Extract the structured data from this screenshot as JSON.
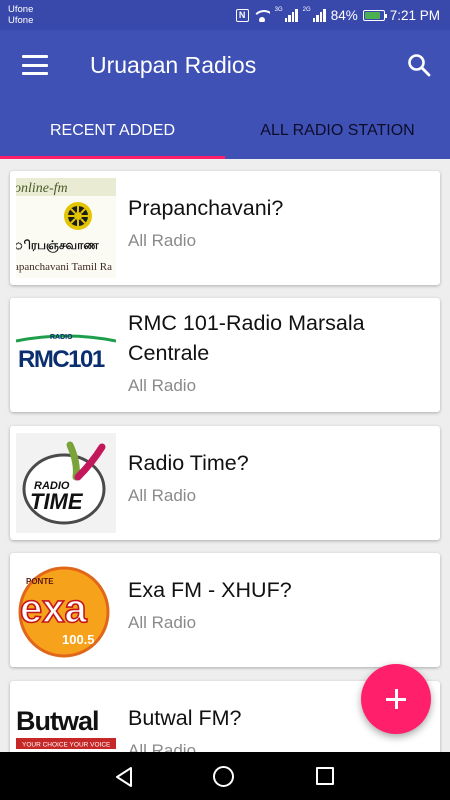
{
  "status_bar": {
    "carrier_1": "Ufone",
    "carrier_2": "Ufone",
    "nfc": "N",
    "net_1": "3G",
    "net_2": "2G",
    "battery": "84%",
    "battery_level": 0.84,
    "time": "7:21 PM"
  },
  "toolbar": {
    "title": "Uruapan Radios",
    "menu_icon": "hamburger-menu-icon",
    "search_icon": "search-icon"
  },
  "tabs": [
    {
      "label": "RECENT ADDED",
      "active": true
    },
    {
      "label": "ALL RADIO STATION",
      "active": false
    }
  ],
  "stations": [
    {
      "name": "Prapanchavani?",
      "category": "All Radio",
      "logo": {
        "top_text": "online-fm",
        "mid_text": "ிரபஞ்சவாண",
        "bottom_text": "apanchavani Tamil Ra"
      }
    },
    {
      "name": "RMC 101-Radio Marsala Centrale",
      "category": "All Radio",
      "logo": {
        "small_text": "RADIO",
        "main_text": "RMC101"
      }
    },
    {
      "name": "Radio Time?",
      "category": "All Radio",
      "logo": {
        "text_1": "RADIO",
        "text_2": "TIME"
      }
    },
    {
      "name": "Exa FM - XHUF?",
      "category": "All Radio",
      "logo": {
        "text_1": "PONTE",
        "text_2": "exa",
        "text_3": "100.5"
      }
    },
    {
      "name": "Butwal FM?",
      "category": "All Radio",
      "logo": {
        "text_1": "Butwal",
        "text_2": "YOUR CHOICE YOUR VOICE"
      }
    }
  ],
  "fab": {
    "icon": "plus-icon"
  },
  "nav_bar": {
    "back_icon": "back-icon",
    "home_icon": "home-icon",
    "recent_icon": "recent-apps-icon"
  },
  "colors": {
    "primary": "#3f51b5",
    "status_bar": "#3949ab",
    "accent": "#ff1f6b"
  }
}
